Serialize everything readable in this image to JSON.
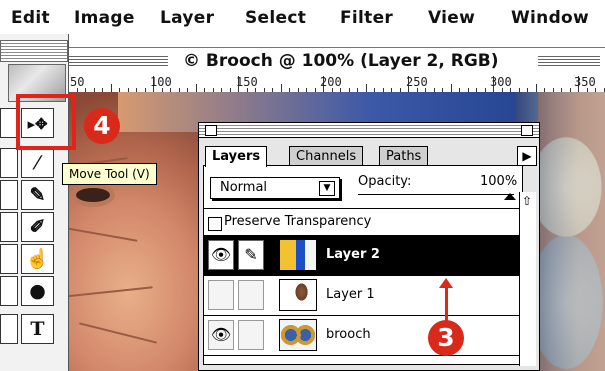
{
  "menubar": {
    "items": [
      "Edit",
      "Image",
      "Layer",
      "Select",
      "Filter",
      "View",
      "Window"
    ]
  },
  "document": {
    "title": "© Brooch @ 100% (Layer 2, RGB)"
  },
  "ruler": {
    "labels": [
      "50",
      "100",
      "150",
      "200",
      "250",
      "300",
      "350"
    ]
  },
  "tooltip": {
    "text": "Move Tool (V)"
  },
  "annotations": {
    "step_tool": "4",
    "step_layer": "3",
    "color": "#d8291b"
  },
  "toolbox": {
    "tools": [
      {
        "name": "move-tool",
        "icon": "move-icon",
        "glyph": "▸✥"
      },
      {
        "name": "eyedropper-tool",
        "icon": "eyedropper-icon",
        "glyph": "⁄"
      },
      {
        "name": "brush-tool",
        "icon": "brush-icon",
        "glyph": "✎"
      },
      {
        "name": "pencil-tool",
        "icon": "pencil-icon",
        "glyph": "✐"
      },
      {
        "name": "smudge-tool",
        "icon": "smudge-icon",
        "glyph": "☝"
      },
      {
        "name": "burn-tool",
        "icon": "burn-icon",
        "glyph": "●"
      },
      {
        "name": "type-tool",
        "icon": "type-icon",
        "glyph": "T"
      }
    ]
  },
  "layers_palette": {
    "tabs": [
      "Layers",
      "Channels",
      "Paths"
    ],
    "active_tab": "Layers",
    "blend_mode": "Normal",
    "opacity_label": "Opacity:",
    "opacity_value": "100%",
    "opacity": 1.0,
    "preserve_transparency_label": "Preserve Transparency",
    "preserve_transparency": false,
    "layers": [
      {
        "name": "Layer 2",
        "visible": true,
        "paintable": true,
        "selected": true
      },
      {
        "name": "Layer 1",
        "visible": false,
        "paintable": false,
        "selected": false
      },
      {
        "name": "brooch",
        "visible": true,
        "paintable": false,
        "selected": false
      }
    ]
  }
}
